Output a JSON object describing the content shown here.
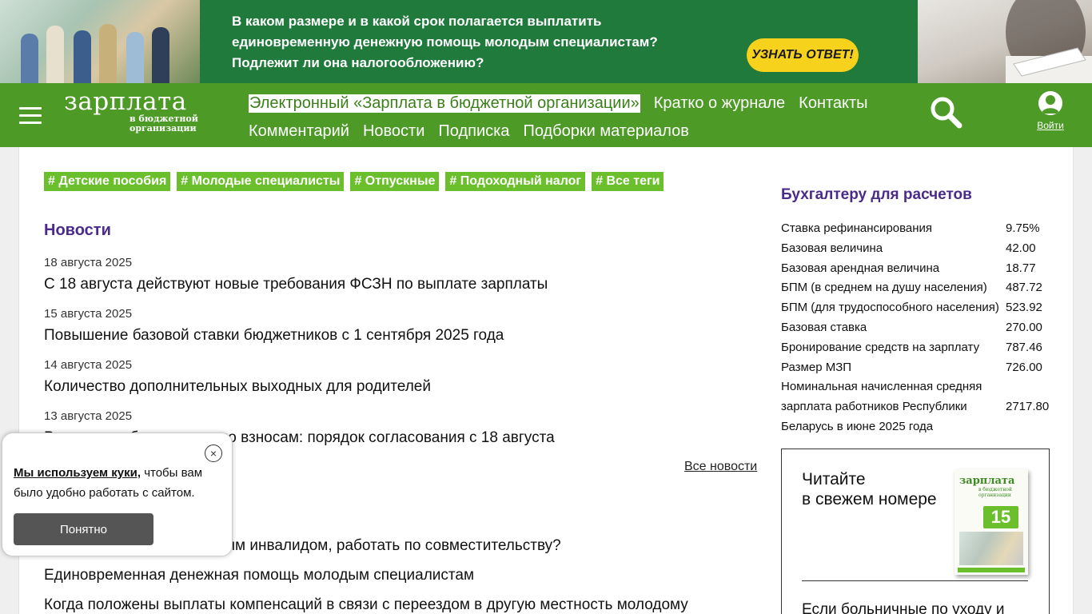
{
  "banner": {
    "text_line1": "В каком размере и в какой срок полагается выплатить",
    "text_line2": "единовременную денежную помощь молодым специалистам?",
    "text_line3": "Подлежит ли она налогообложению?",
    "button": "УЗНАТЬ ОТВЕТ!"
  },
  "header": {
    "logo_main": "зарплата",
    "logo_sub1": "в бюджетной",
    "logo_sub2": "организации",
    "nav_row1": [
      "Электронный «Зарплата в бюджетной организации»",
      "Кратко о журнале",
      "Контакты"
    ],
    "nav_row2": [
      "Комментарий",
      "Новости",
      "Подписка",
      "Подборки материалов"
    ],
    "login": "Войти"
  },
  "tags": [
    "# Детские пособия",
    "# Молодые специалисты",
    "# Отпускные",
    "# Подоходный налог",
    "# Все теги"
  ],
  "news": {
    "title": "Новости",
    "items": [
      {
        "date": "18 августа 2025",
        "text": "С 18 августа действуют новые требования ФСЗН по выплате зарплаты"
      },
      {
        "date": "15 августа 2025",
        "text": "Повышение базовой ставки бюджетников с 1 сентября 2025 года"
      },
      {
        "date": "14 августа 2025",
        "text": "Количество дополнительных выходных для родителей"
      },
      {
        "date": "13 августа 2025",
        "text": "Рассрочка обязательств по взносам: порядок согласования с 18 августа"
      }
    ],
    "all_link": "Все новости"
  },
  "articles": [
    "Можно ли лицу, признанным инвалидом, работать по совместительству?",
    "Единовременная денежная помощь молодым специалистам",
    "Когда положены выплаты компенсаций в связи с переездом в другую местность молодому"
  ],
  "sidebar": {
    "title": "Бухгалтеру для расчетов",
    "rates": [
      {
        "label": "Ставка рефинансирования",
        "value": "9.75%"
      },
      {
        "label": "Базовая величина",
        "value": "42.00"
      },
      {
        "label": "Базовая арендная величина",
        "value": "18.77"
      },
      {
        "label": "БПМ (в среднем на душу населения)",
        "value": "487.72"
      },
      {
        "label": "БПМ (для трудоспособного населения)",
        "value": "523.92"
      },
      {
        "label": "Базовая ставка",
        "value": "270.00"
      },
      {
        "label": "Бронирование средств на зарплату",
        "value": "787.46"
      },
      {
        "label": "Размер МЗП",
        "value": "726.00"
      },
      {
        "label": "Номинальная начисленная средняя зарплата работников Республики Беларусь в июне 2025 года",
        "value": "2717.80"
      }
    ],
    "issue": {
      "line1": "Читайте",
      "line2": "в свежем номере",
      "cover_logo": "зарплата",
      "cover_sub": "в бюджетной организации",
      "cover_number": "15",
      "next": "Если больничные по уходу и"
    }
  },
  "cookie": {
    "bold": "Мы используем куки,",
    "text": " чтобы вам было удобно работать с сайтом.",
    "button": "Понятно",
    "close": "×"
  }
}
